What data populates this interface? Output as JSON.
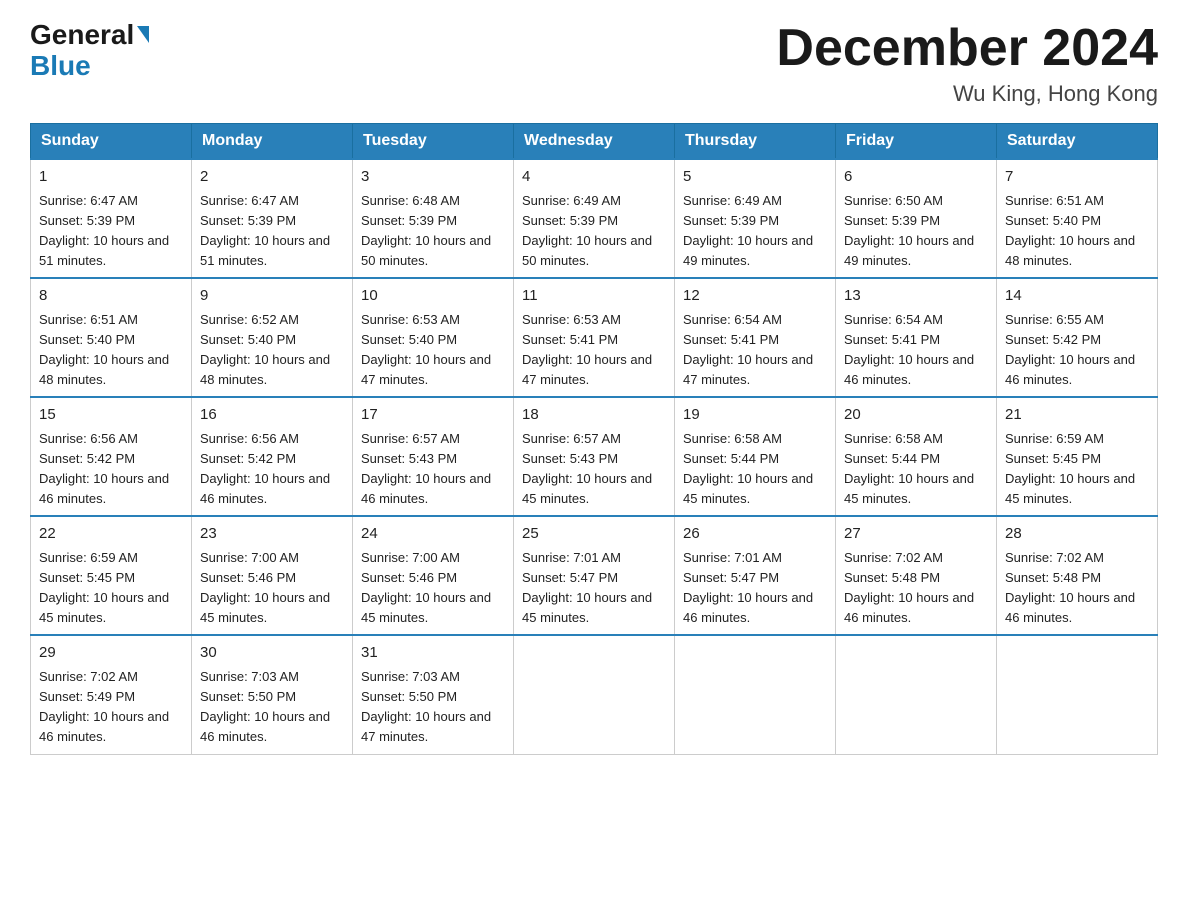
{
  "logo": {
    "general": "General",
    "blue": "Blue"
  },
  "header": {
    "month_title": "December 2024",
    "location": "Wu King, Hong Kong"
  },
  "weekdays": [
    "Sunday",
    "Monday",
    "Tuesday",
    "Wednesday",
    "Thursday",
    "Friday",
    "Saturday"
  ],
  "weeks": [
    [
      {
        "day": "1",
        "sunrise": "6:47 AM",
        "sunset": "5:39 PM",
        "daylight": "10 hours and 51 minutes."
      },
      {
        "day": "2",
        "sunrise": "6:47 AM",
        "sunset": "5:39 PM",
        "daylight": "10 hours and 51 minutes."
      },
      {
        "day": "3",
        "sunrise": "6:48 AM",
        "sunset": "5:39 PM",
        "daylight": "10 hours and 50 minutes."
      },
      {
        "day": "4",
        "sunrise": "6:49 AM",
        "sunset": "5:39 PM",
        "daylight": "10 hours and 50 minutes."
      },
      {
        "day": "5",
        "sunrise": "6:49 AM",
        "sunset": "5:39 PM",
        "daylight": "10 hours and 49 minutes."
      },
      {
        "day": "6",
        "sunrise": "6:50 AM",
        "sunset": "5:39 PM",
        "daylight": "10 hours and 49 minutes."
      },
      {
        "day": "7",
        "sunrise": "6:51 AM",
        "sunset": "5:40 PM",
        "daylight": "10 hours and 48 minutes."
      }
    ],
    [
      {
        "day": "8",
        "sunrise": "6:51 AM",
        "sunset": "5:40 PM",
        "daylight": "10 hours and 48 minutes."
      },
      {
        "day": "9",
        "sunrise": "6:52 AM",
        "sunset": "5:40 PM",
        "daylight": "10 hours and 48 minutes."
      },
      {
        "day": "10",
        "sunrise": "6:53 AM",
        "sunset": "5:40 PM",
        "daylight": "10 hours and 47 minutes."
      },
      {
        "day": "11",
        "sunrise": "6:53 AM",
        "sunset": "5:41 PM",
        "daylight": "10 hours and 47 minutes."
      },
      {
        "day": "12",
        "sunrise": "6:54 AM",
        "sunset": "5:41 PM",
        "daylight": "10 hours and 47 minutes."
      },
      {
        "day": "13",
        "sunrise": "6:54 AM",
        "sunset": "5:41 PM",
        "daylight": "10 hours and 46 minutes."
      },
      {
        "day": "14",
        "sunrise": "6:55 AM",
        "sunset": "5:42 PM",
        "daylight": "10 hours and 46 minutes."
      }
    ],
    [
      {
        "day": "15",
        "sunrise": "6:56 AM",
        "sunset": "5:42 PM",
        "daylight": "10 hours and 46 minutes."
      },
      {
        "day": "16",
        "sunrise": "6:56 AM",
        "sunset": "5:42 PM",
        "daylight": "10 hours and 46 minutes."
      },
      {
        "day": "17",
        "sunrise": "6:57 AM",
        "sunset": "5:43 PM",
        "daylight": "10 hours and 46 minutes."
      },
      {
        "day": "18",
        "sunrise": "6:57 AM",
        "sunset": "5:43 PM",
        "daylight": "10 hours and 45 minutes."
      },
      {
        "day": "19",
        "sunrise": "6:58 AM",
        "sunset": "5:44 PM",
        "daylight": "10 hours and 45 minutes."
      },
      {
        "day": "20",
        "sunrise": "6:58 AM",
        "sunset": "5:44 PM",
        "daylight": "10 hours and 45 minutes."
      },
      {
        "day": "21",
        "sunrise": "6:59 AM",
        "sunset": "5:45 PM",
        "daylight": "10 hours and 45 minutes."
      }
    ],
    [
      {
        "day": "22",
        "sunrise": "6:59 AM",
        "sunset": "5:45 PM",
        "daylight": "10 hours and 45 minutes."
      },
      {
        "day": "23",
        "sunrise": "7:00 AM",
        "sunset": "5:46 PM",
        "daylight": "10 hours and 45 minutes."
      },
      {
        "day": "24",
        "sunrise": "7:00 AM",
        "sunset": "5:46 PM",
        "daylight": "10 hours and 45 minutes."
      },
      {
        "day": "25",
        "sunrise": "7:01 AM",
        "sunset": "5:47 PM",
        "daylight": "10 hours and 45 minutes."
      },
      {
        "day": "26",
        "sunrise": "7:01 AM",
        "sunset": "5:47 PM",
        "daylight": "10 hours and 46 minutes."
      },
      {
        "day": "27",
        "sunrise": "7:02 AM",
        "sunset": "5:48 PM",
        "daylight": "10 hours and 46 minutes."
      },
      {
        "day": "28",
        "sunrise": "7:02 AM",
        "sunset": "5:48 PM",
        "daylight": "10 hours and 46 minutes."
      }
    ],
    [
      {
        "day": "29",
        "sunrise": "7:02 AM",
        "sunset": "5:49 PM",
        "daylight": "10 hours and 46 minutes."
      },
      {
        "day": "30",
        "sunrise": "7:03 AM",
        "sunset": "5:50 PM",
        "daylight": "10 hours and 46 minutes."
      },
      {
        "day": "31",
        "sunrise": "7:03 AM",
        "sunset": "5:50 PM",
        "daylight": "10 hours and 47 minutes."
      },
      null,
      null,
      null,
      null
    ]
  ]
}
